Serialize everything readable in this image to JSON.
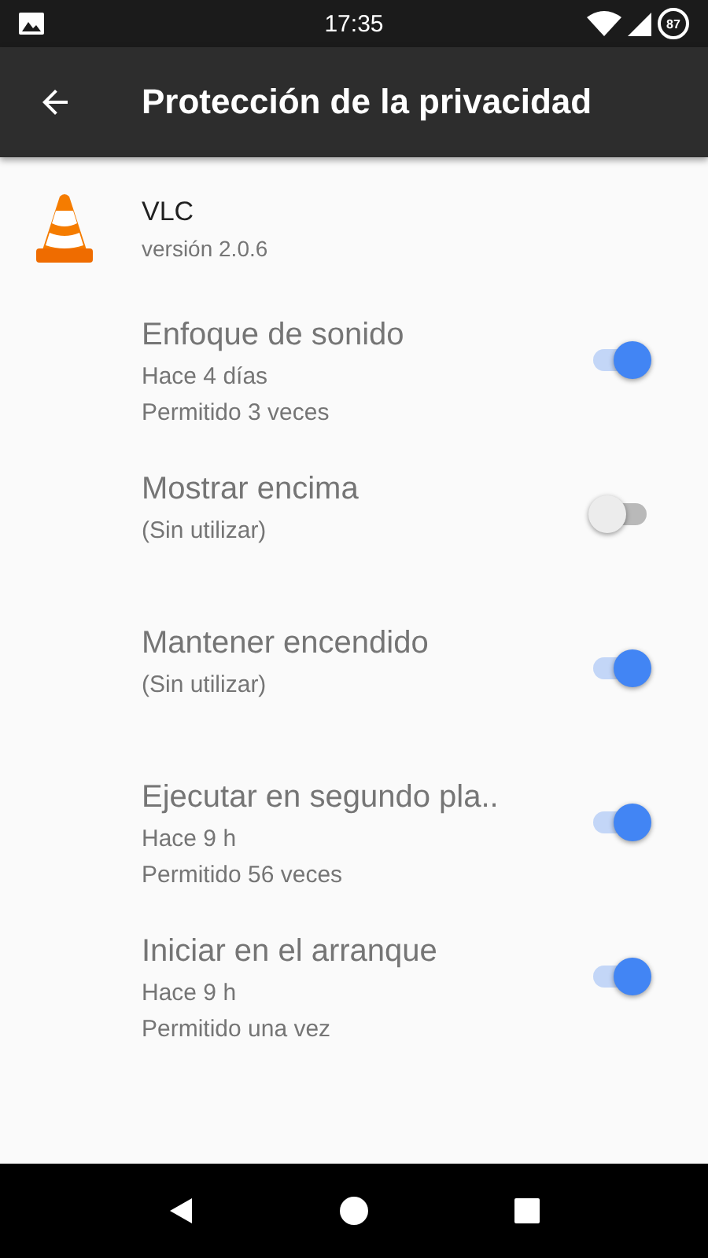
{
  "status_bar": {
    "time": "17:35",
    "battery": "87"
  },
  "toolbar": {
    "title": "Protección de la privacidad"
  },
  "app": {
    "name": "VLC",
    "version": "versión 2.0.6"
  },
  "permissions": [
    {
      "title": "Enfoque de sonido",
      "lines": [
        "Hace 4 días",
        "Permitido 3 veces"
      ],
      "on": true
    },
    {
      "title": "Mostrar encima",
      "lines": [
        "(Sin utilizar)"
      ],
      "on": false
    },
    {
      "title": "Mantener encendido",
      "lines": [
        "(Sin utilizar)"
      ],
      "on": true
    },
    {
      "title": "Ejecutar en segundo pla..",
      "lines": [
        "Hace 9 h",
        "Permitido 56 veces"
      ],
      "on": true
    },
    {
      "title": "Iniciar en el arranque",
      "lines": [
        "Hace 9 h",
        "Permitido una vez"
      ],
      "on": true
    }
  ]
}
